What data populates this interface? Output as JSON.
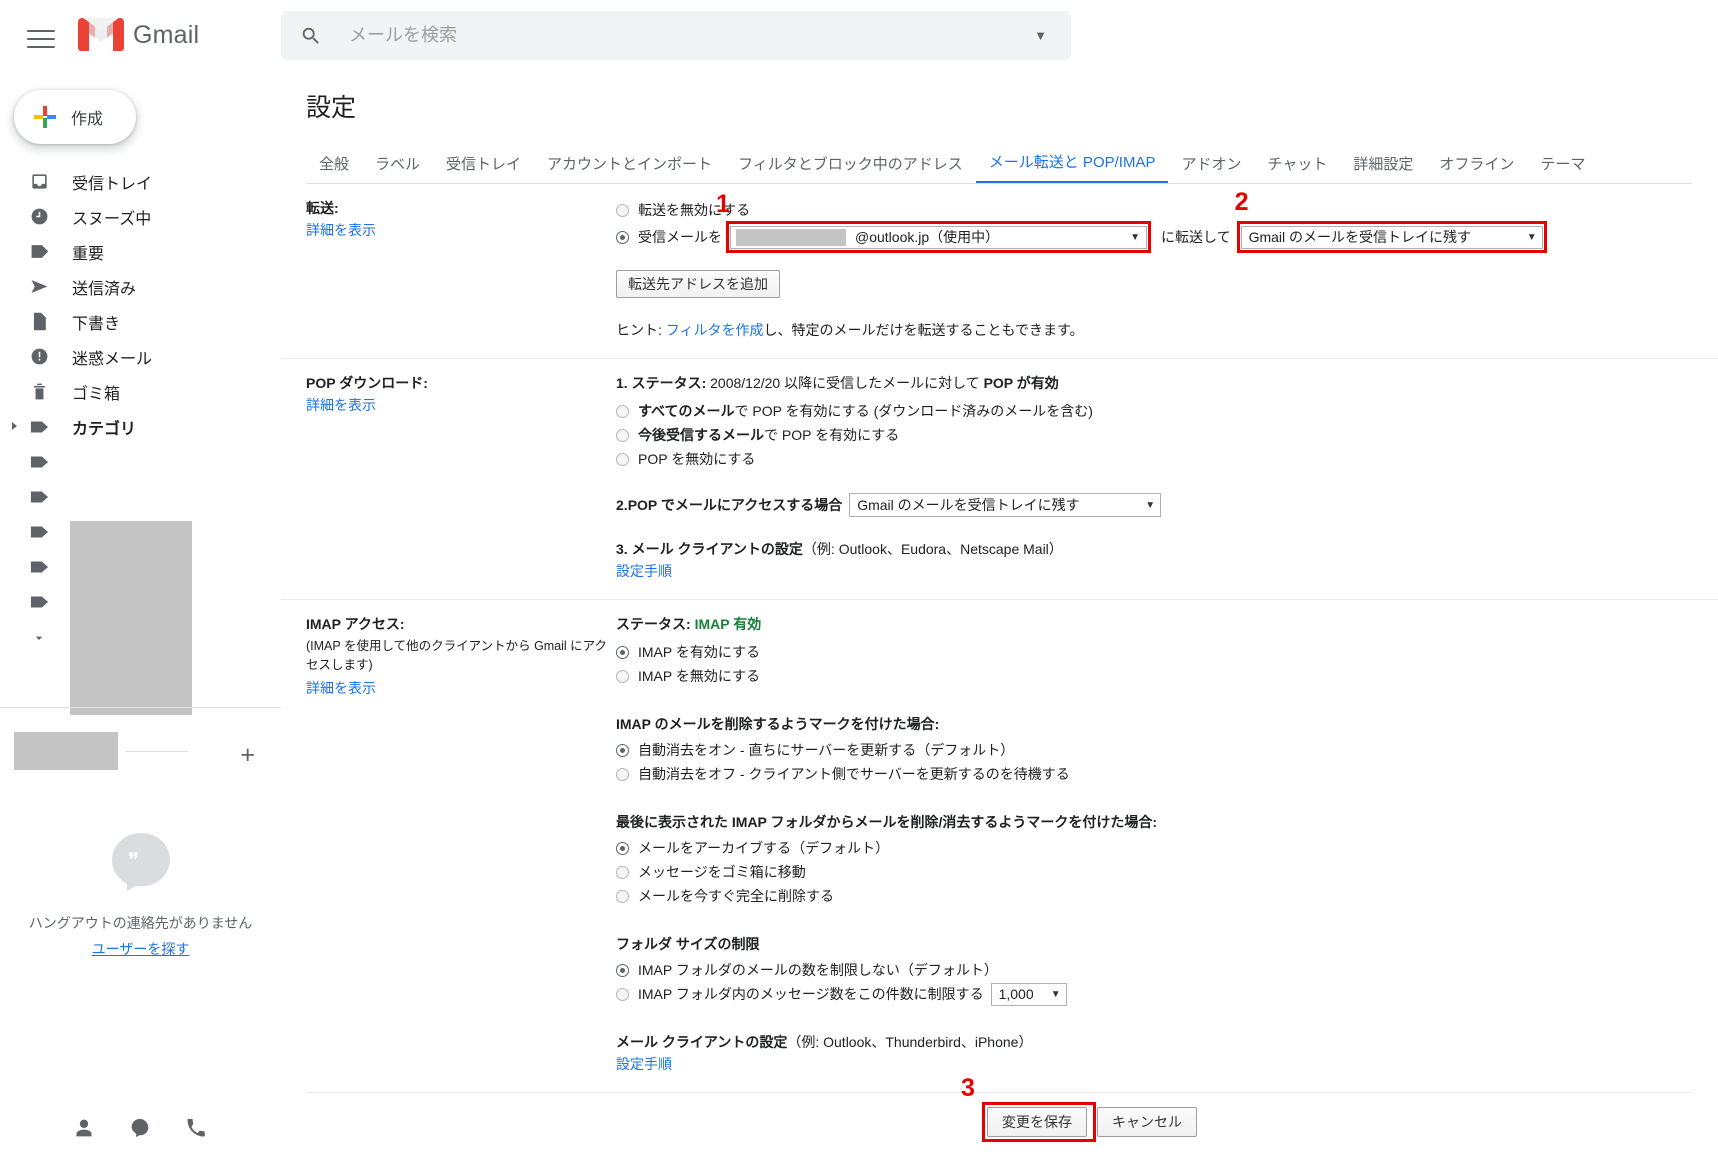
{
  "header": {
    "menu_icon": "hamburger-icon",
    "logo_text": "Gmail",
    "search_placeholder": "メールを検索",
    "search_value": "",
    "search_icon": "search-icon",
    "search_options_icon": "chevron-down-icon"
  },
  "sidebar": {
    "compose_label": "作成",
    "items": [
      {
        "label": "受信トレイ",
        "icon": "inbox-icon",
        "bold": false,
        "redacted": false
      },
      {
        "label": "スヌーズ中",
        "icon": "clock-icon",
        "bold": false,
        "redacted": false
      },
      {
        "label": "重要",
        "icon": "important-label-icon",
        "bold": false,
        "redacted": false
      },
      {
        "label": "送信済み",
        "icon": "send-icon",
        "bold": false,
        "redacted": false
      },
      {
        "label": "下書き",
        "icon": "draft-icon",
        "bold": false,
        "redacted": false
      },
      {
        "label": "迷惑メール",
        "icon": "spam-icon",
        "bold": false,
        "redacted": false
      },
      {
        "label": "ゴミ箱",
        "icon": "trash-icon",
        "bold": false,
        "redacted": false
      },
      {
        "label": "カテゴリ",
        "icon": "label-icon",
        "bold": true,
        "redacted": false
      },
      {
        "label": "",
        "icon": "label-icon",
        "bold": false,
        "redacted": true
      },
      {
        "label": "",
        "icon": "label-icon",
        "bold": false,
        "redacted": true
      },
      {
        "label": "",
        "icon": "label-icon",
        "bold": false,
        "redacted": true
      },
      {
        "label": "",
        "icon": "label-icon",
        "bold": false,
        "redacted": true
      },
      {
        "label": "",
        "icon": "label-icon",
        "bold": false,
        "redacted": true
      }
    ],
    "more_label": "もっと見る",
    "hangouts": {
      "add_icon": "plus-icon",
      "empty_text": "ハングアウトの連絡先がありません",
      "find_users_label": "ユーザーを探す",
      "footer_icons": [
        "person-icon",
        "hangouts-icon",
        "phone-icon"
      ]
    }
  },
  "main": {
    "page_title": "設定",
    "tabs": [
      {
        "label": "全般",
        "active": false
      },
      {
        "label": "ラベル",
        "active": false
      },
      {
        "label": "受信トレイ",
        "active": false
      },
      {
        "label": "アカウントとインポート",
        "active": false
      },
      {
        "label": "フィルタとブロック中のアドレス",
        "active": false
      },
      {
        "label": "メール転送と POP/IMAP",
        "active": true
      },
      {
        "label": "アドオン",
        "active": false
      },
      {
        "label": "チャット",
        "active": false
      },
      {
        "label": "詳細設定",
        "active": false
      },
      {
        "label": "オフライン",
        "active": false
      },
      {
        "label": "テーマ",
        "active": false
      }
    ],
    "forwarding": {
      "section_title": "転送:",
      "details_link": "詳細を表示",
      "option_disable": "転送を無効にする",
      "option_disable_selected": false,
      "option_forward_prefix": "受信メールを",
      "option_forward_selected": true,
      "address_redacted": true,
      "address_value": "@outlook.jp（使用中）",
      "between_text": "に転送して",
      "action_value": "Gmail のメールを受信トレイに残す",
      "add_address_button": "転送先アドレスを追加",
      "hint_prefix": "ヒント: ",
      "hint_link": "フィルタを作成",
      "hint_suffix": "し、特定のメールだけを転送することもできます。"
    },
    "pop": {
      "section_title": "POP ダウンロード:",
      "details_link": "詳細を表示",
      "status_num": "1. ",
      "status_label": "ステータス:",
      "status_text": " 2008/12/20 以降に受信したメールに対して ",
      "status_highlight": "POP が有効",
      "options": [
        {
          "bold": "すべてのメール",
          "rest": "で POP を有効にする (ダウンロード済みのメールを含む)",
          "selected": false
        },
        {
          "bold": "今後受信するメール",
          "rest": "で POP を有効にする",
          "selected": false
        },
        {
          "bold": "",
          "rest": "POP を無効にする",
          "selected": false,
          "mid_bold": "無効"
        }
      ],
      "access_num": "2. ",
      "access_label": "POP でメールにアクセスする場合",
      "access_value": "Gmail のメールを受信トレイに残す",
      "client_num": "3. ",
      "client_label": "メール クライアントの設定",
      "client_examples": "（例: Outlook、Eudora、Netscape Mail）",
      "client_link": "設定手順"
    },
    "imap": {
      "section_title": "IMAP アクセス:",
      "section_note": "(IMAP を使用して他のクライアントから Gmail にアクセスします)",
      "details_link": "詳細を表示",
      "status_label": "ステータス: ",
      "status_value": "IMAP 有効",
      "enable_options": [
        {
          "label": "IMAP を有効にする",
          "selected": true
        },
        {
          "label": "IMAP を無効にする",
          "selected": false
        }
      ],
      "delete_mark_title": "IMAP のメールを削除するようマークを付けた場合:",
      "delete_mark_options": [
        {
          "label": "自動消去をオン - 直ちにサーバーを更新する（デフォルト）",
          "selected": true
        },
        {
          "label": "自動消去をオフ - クライアント側でサーバーを更新するのを待機する",
          "selected": false
        }
      ],
      "last_folder_title": "最後に表示された IMAP フォルダからメールを削除/消去するようマークを付けた場合:",
      "last_folder_options": [
        {
          "label": "メールをアーカイブする（デフォルト）",
          "selected": true
        },
        {
          "label": "メッセージをゴミ箱に移動",
          "selected": false
        },
        {
          "label": "メールを今すぐ完全に削除する",
          "selected": false
        }
      ],
      "folder_size_title": "フォルダ サイズの制限",
      "folder_size_options": [
        {
          "label": "IMAP フォルダのメールの数を制限しない（デフォルト）",
          "selected": true
        },
        {
          "label": "IMAP フォルダ内のメッセージ数をこの件数に制限する",
          "selected": false,
          "value": "1,000"
        }
      ],
      "client_label": "メール クライアントの設定",
      "client_examples": "（例: Outlook、Thunderbird、iPhone）",
      "client_link": "設定手順"
    },
    "footer": {
      "save_label": "変更を保存",
      "cancel_label": "キャンセル"
    }
  },
  "annotations": [
    {
      "num": "1",
      "target": "forwarding-address-select"
    },
    {
      "num": "2",
      "target": "forwarding-action-select"
    },
    {
      "num": "3",
      "target": "save-changes-button"
    }
  ],
  "colors": {
    "accent": "#1a73e8",
    "annotation": "#e60000",
    "status_green": "#188038",
    "redaction": "#c4c4c4"
  }
}
